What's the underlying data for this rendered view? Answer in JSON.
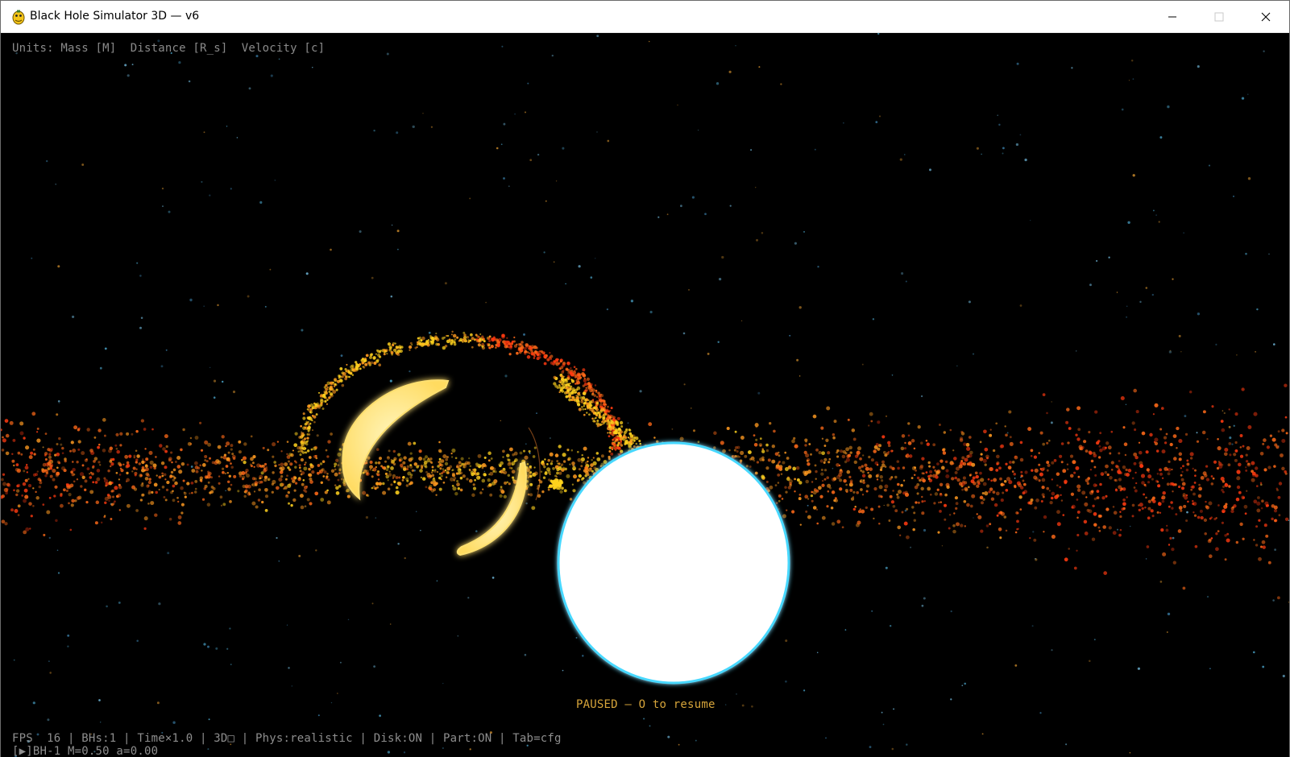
{
  "window": {
    "title": "Black Hole Simulator 3D  —  v6",
    "controls": [
      "minimize",
      "maximize",
      "close"
    ]
  },
  "hud": {
    "units": "Units: Mass [M]  Distance [R_s]  Velocity [c]",
    "paused": "PAUSED — O to resume",
    "status": "FPS  16 | BHs:1 | Time×1.0 | 3D□ | Phys:realistic | Disk:ON | Part:ON | Tab=cfg",
    "bh_info": "[▶]BH-1 M=0.50 a=0.00"
  },
  "scene": {
    "background": "#000000",
    "disk_colors": [
      "#ff3a10",
      "#ff6a18",
      "#ff9a20",
      "#ffd21e"
    ],
    "background_star_colors": [
      "#4aa3c8",
      "#6fb6d8",
      "#c8882a",
      "#3a7ea8"
    ],
    "lensed_arc_color": "#ffe890",
    "star_color": "#ffffff",
    "star_glow": "#46d8ff",
    "paused": true
  }
}
